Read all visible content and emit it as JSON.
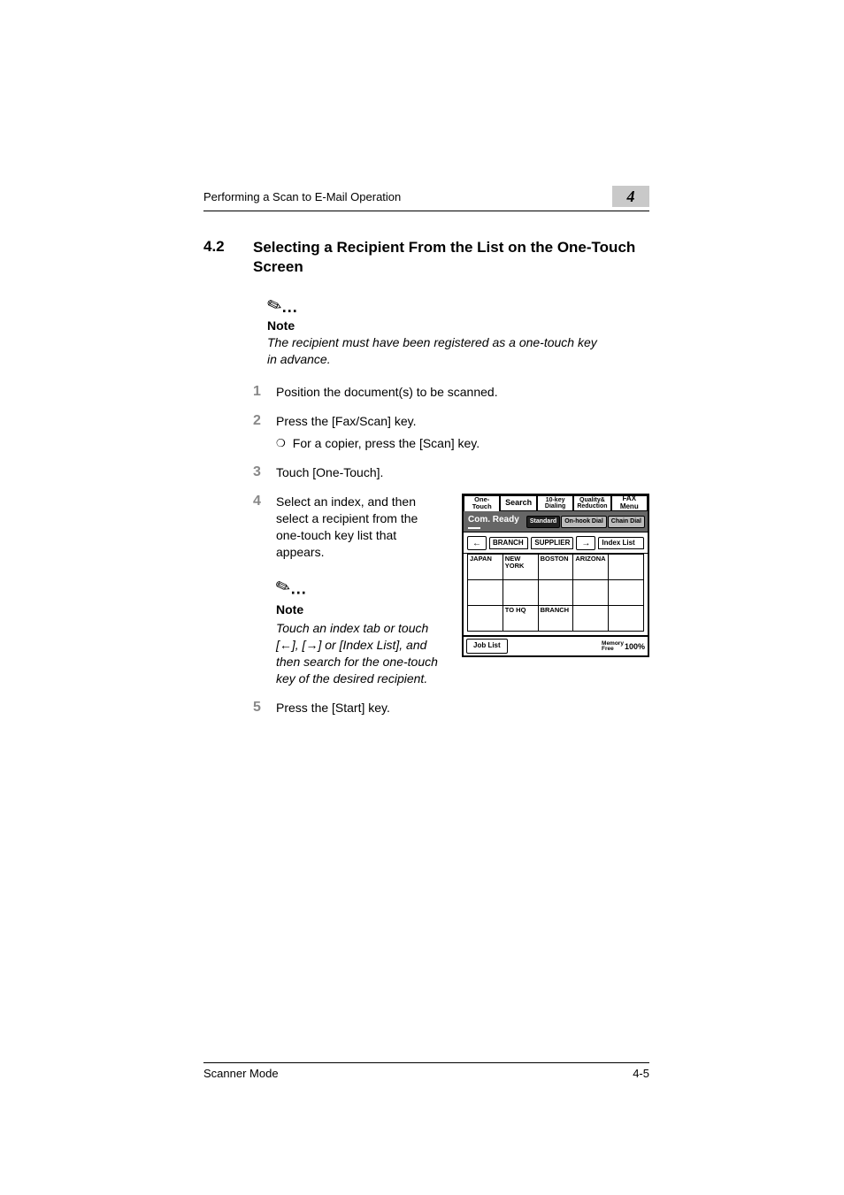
{
  "header": {
    "running_head": "Performing a Scan to E-Mail Operation",
    "chapter_number": "4"
  },
  "section": {
    "number": "4.2",
    "title": "Selecting a Recipient From the List on the One-Touch Screen"
  },
  "top_note": {
    "heading": "Note",
    "text": "The recipient must have been registered as a one-touch key in advance."
  },
  "steps": {
    "s1_num": "1",
    "s1_text": "Position the document(s) to be scanned.",
    "s2_num": "2",
    "s2_text": "Press the [Fax/Scan] key.",
    "s2_sub_bullet": "❍",
    "s2_sub_text": "For a copier, press the [Scan] key.",
    "s3_num": "3",
    "s3_text": "Touch [One-Touch].",
    "s4_num": "4",
    "s4_text": "Select an index, and then select a recipient from the one-touch key list that appears.",
    "s4_note_heading": "Note",
    "s4_note_text": "Touch an index tab or touch [←], [→] or [Index List], and then search for the one-touch key of the desired recipient.",
    "s5_num": "5",
    "s5_text": "Press the [Start] key."
  },
  "figure": {
    "tabs": {
      "one_touch": "One-Touch",
      "search": "Search",
      "ten_key_l1": "10-key",
      "ten_key_l2": "Dialing",
      "quality_l1": "Quality&",
      "quality_l2": "Reduction",
      "fax_menu": "FAX Menu"
    },
    "status": {
      "com_ready": "Com. Ready",
      "standard": "Standard",
      "on_hook": "On-hook Dial",
      "chain": "Chain Dial"
    },
    "index_row": {
      "left_arrow": "←",
      "branch": "BRANCH",
      "supplier": "SUPPLIER",
      "right_arrow": "→",
      "index_list": "Index List"
    },
    "cells": {
      "r0c0": "JAPAN",
      "r0c1": "NEW YORK",
      "r0c2": "BOSTON",
      "r0c3": "ARIZONA",
      "r2c1": "TO HQ",
      "r2c2": "BRANCH"
    },
    "bottom": {
      "job_list": "Job List",
      "memory_l1": "Memory",
      "memory_l2": "Free",
      "percent": "100%"
    }
  },
  "footer": {
    "left": "Scanner Mode",
    "right": "4-5"
  }
}
